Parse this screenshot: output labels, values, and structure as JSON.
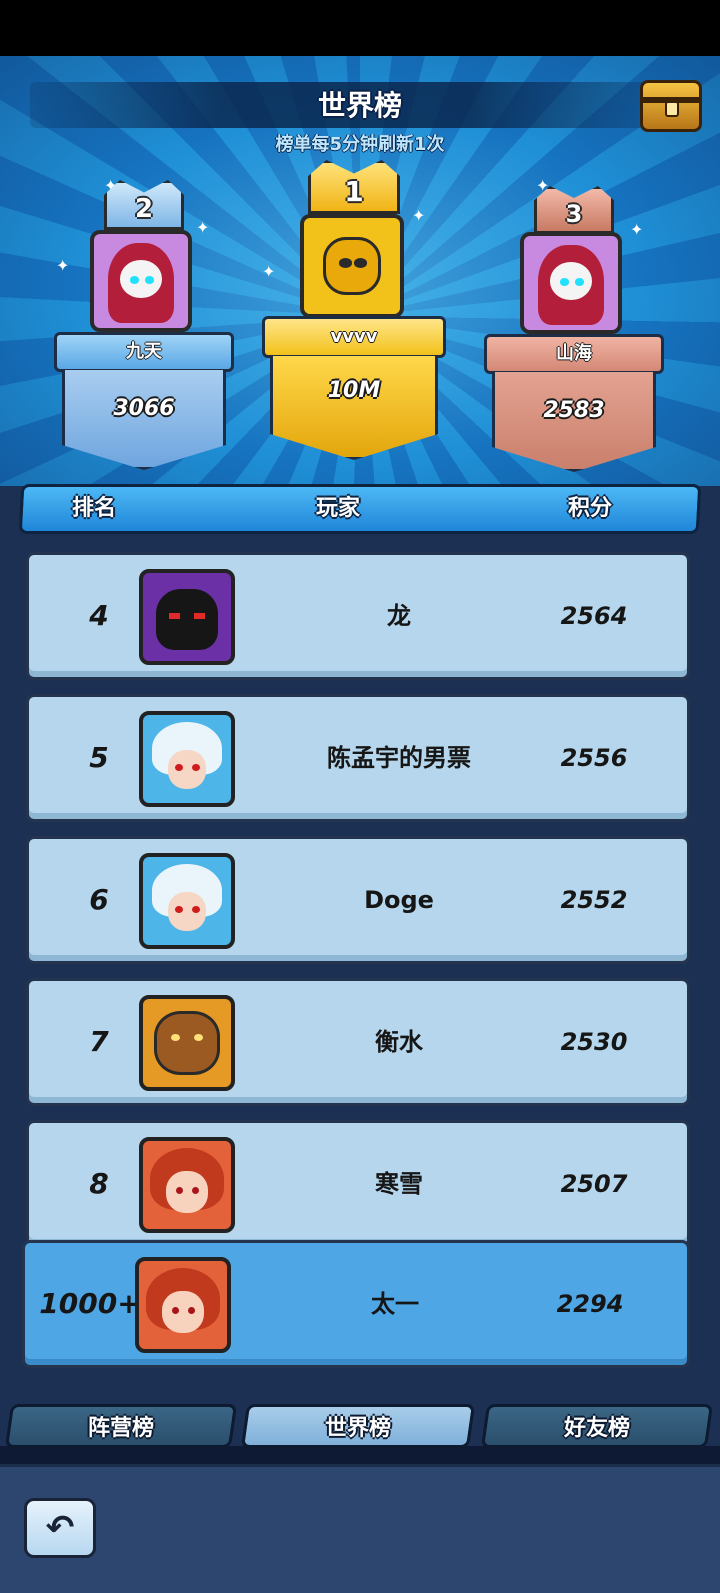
{
  "header": {
    "title": "世界榜",
    "subtitle": "榜单每5分钟刷新1次",
    "chest_icon": "treasure-chest-icon"
  },
  "podium": [
    {
      "rank": "2",
      "name": "九天",
      "score": "3066",
      "avatar": "ghost"
    },
    {
      "rank": "1",
      "name": "vvvv",
      "score": "10M",
      "avatar": "bird"
    },
    {
      "rank": "3",
      "name": "山海",
      "score": "2583",
      "avatar": "ghost"
    }
  ],
  "table": {
    "columns": [
      "排名",
      "玩家",
      "积分"
    ],
    "rows": [
      {
        "rank": "4",
        "name": "龙",
        "score": "2564",
        "avatar": "demon"
      },
      {
        "rank": "5",
        "name": "陈孟宇的男票",
        "score": "2556",
        "avatar": "wolf"
      },
      {
        "rank": "6",
        "name": "Doge",
        "score": "2552",
        "avatar": "wolf"
      },
      {
        "rank": "7",
        "name": "衡水",
        "score": "2530",
        "avatar": "beast"
      },
      {
        "rank": "8",
        "name": "寒雪",
        "score": "2507",
        "avatar": "girl"
      }
    ],
    "self_row": {
      "rank": "1000+",
      "name": "太一",
      "score": "2294",
      "avatar": "girl"
    }
  },
  "tabs": [
    {
      "label": "阵营榜",
      "active": false
    },
    {
      "label": "世界榜",
      "active": true
    },
    {
      "label": "好友榜",
      "active": false
    }
  ],
  "footer": {
    "back_icon": "back-arrow-icon"
  },
  "colors": {
    "gold": "#f2c21a",
    "silver": "#7fb6e6",
    "bronze": "#d28a7a",
    "row": "#b5d6ec",
    "self_row": "#4fa6e5"
  }
}
